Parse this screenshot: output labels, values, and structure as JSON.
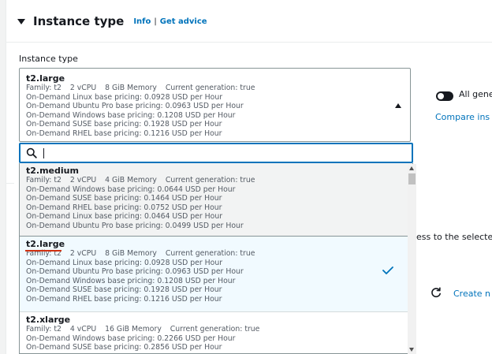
{
  "header": {
    "title": "Instance type",
    "info_link": "Info",
    "separator": "|",
    "advice_link": "Get advice"
  },
  "field": {
    "label": "Instance type"
  },
  "selected": {
    "name": "t2.large",
    "meta": [
      "Family: t2",
      "2 vCPU",
      "8 GiB Memory",
      "Current generation: true"
    ],
    "pricing": [
      "On-Demand Linux base pricing: 0.0928 USD per Hour",
      "On-Demand Ubuntu Pro base pricing: 0.0963 USD per Hour",
      "On-Demand Windows base pricing: 0.1208 USD per Hour",
      "On-Demand SUSE base pricing: 0.1928 USD per Hour",
      "On-Demand RHEL base pricing: 0.1216 USD per Hour"
    ]
  },
  "search": {
    "value": "",
    "placeholder": ""
  },
  "options": [
    {
      "name": "t2.medium",
      "meta": [
        "Family: t2",
        "2 vCPU",
        "4 GiB Memory",
        "Current generation: true"
      ],
      "pricing": [
        "On-Demand Windows base pricing: 0.0644 USD per Hour",
        "On-Demand SUSE base pricing: 0.1464 USD per Hour",
        "On-Demand RHEL base pricing: 0.0752 USD per Hour",
        "On-Demand Linux base pricing: 0.0464 USD per Hour",
        "On-Demand Ubuntu Pro base pricing: 0.0499 USD per Hour"
      ]
    },
    {
      "name": "t2.large",
      "meta": [
        "Family: t2",
        "2 vCPU",
        "8 GiB Memory",
        "Current generation: true"
      ],
      "pricing": [
        "On-Demand Linux base pricing: 0.0928 USD per Hour",
        "On-Demand Ubuntu Pro base pricing: 0.0963 USD per Hour",
        "On-Demand Windows base pricing: 0.1208 USD per Hour",
        "On-Demand SUSE base pricing: 0.1928 USD per Hour",
        "On-Demand RHEL base pricing: 0.1216 USD per Hour"
      ]
    },
    {
      "name": "t2.xlarge",
      "meta": [
        "Family: t2",
        "4 vCPU",
        "16 GiB Memory",
        "Current generation: true"
      ],
      "pricing": [
        "On-Demand Windows base pricing: 0.2266 USD per Hour",
        "On-Demand SUSE base pricing: 0.2856 USD per Hour"
      ]
    }
  ],
  "side": {
    "toggle_label": "All gene",
    "compare_link": "Compare ins",
    "background_text": "ess to the selected",
    "create_link": "Create n"
  },
  "icons": {
    "section_caret": "caret-down-icon",
    "select_caret": "caret-up-icon",
    "search": "search-icon",
    "check": "check-icon",
    "refresh": "refresh-icon"
  },
  "colors": {
    "link": "#0073bb",
    "focus": "#0073bb",
    "selected_bg": "#f1faff",
    "hover_bg": "#f2f3f3",
    "underline": "#d13212"
  }
}
